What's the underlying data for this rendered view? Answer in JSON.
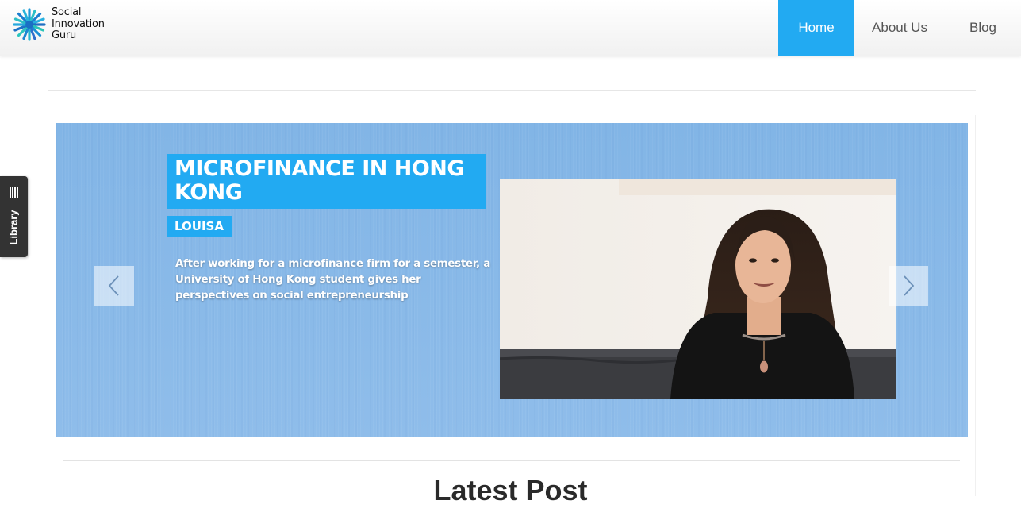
{
  "site": {
    "logo_icon": "starburst-logo-icon",
    "logo_lines": [
      "Social",
      "Innovation",
      "Guru"
    ]
  },
  "nav": {
    "items": [
      {
        "label": "Home",
        "active": true
      },
      {
        "label": "About Us",
        "active": false
      },
      {
        "label": "Blog",
        "active": false
      }
    ]
  },
  "slider": {
    "title": "MICROFINANCE IN HONG KONG",
    "author": "LOUISA",
    "description": "After working for a microfinance firm for a semester, a University of Hong Kong student gives her perspectives on social entrepreneurship",
    "prev_icon": "chevron-left-icon",
    "next_icon": "chevron-right-icon"
  },
  "library_tab": {
    "label": "Library",
    "icon": "library-books-icon"
  },
  "latest": {
    "title": "Latest Post"
  },
  "colors": {
    "accent": "#22aaf2",
    "slider_bg": "#88b9e8",
    "library_tab_bg": "#333333"
  }
}
